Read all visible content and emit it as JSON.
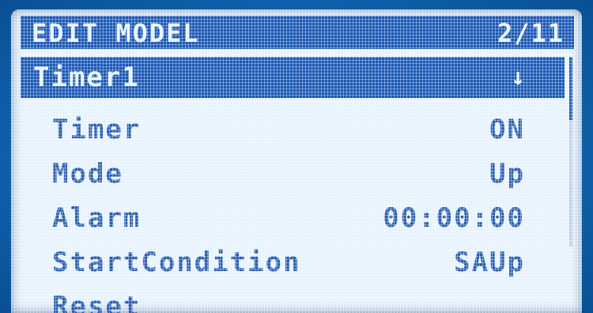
{
  "header": {
    "title": "EDIT MODEL",
    "page": "2/11"
  },
  "selected_item": {
    "label": "Timer1",
    "indicator": "↓"
  },
  "settings": [
    {
      "label": "Timer",
      "value": "ON"
    },
    {
      "label": "Mode",
      "value": "Up"
    },
    {
      "label": "Alarm",
      "value": "00:00:00"
    },
    {
      "label": "StartCondition",
      "value": "SAUp"
    },
    {
      "label": "Reset",
      "value": ""
    }
  ],
  "colors": {
    "bezel": "#0e5ea8",
    "screen_background": "#e6f2fd",
    "highlight": "#1b58b5",
    "text": "#2a5fb0"
  }
}
